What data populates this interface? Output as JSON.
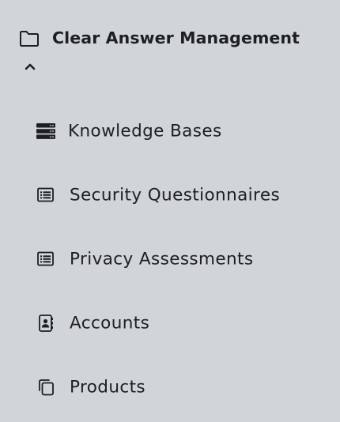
{
  "sidebar": {
    "section": {
      "title": "Clear Answer Management",
      "icon": "folder-icon",
      "expanded_icon": "chevron-up-icon"
    },
    "items": [
      {
        "label": "Knowledge Bases",
        "icon": "database-icon"
      },
      {
        "label": "Security Questionnaires",
        "icon": "list-icon"
      },
      {
        "label": "Privacy Assessments",
        "icon": "list-icon"
      },
      {
        "label": "Accounts",
        "icon": "contact-book-icon"
      },
      {
        "label": "Products",
        "icon": "copy-icon"
      }
    ]
  }
}
